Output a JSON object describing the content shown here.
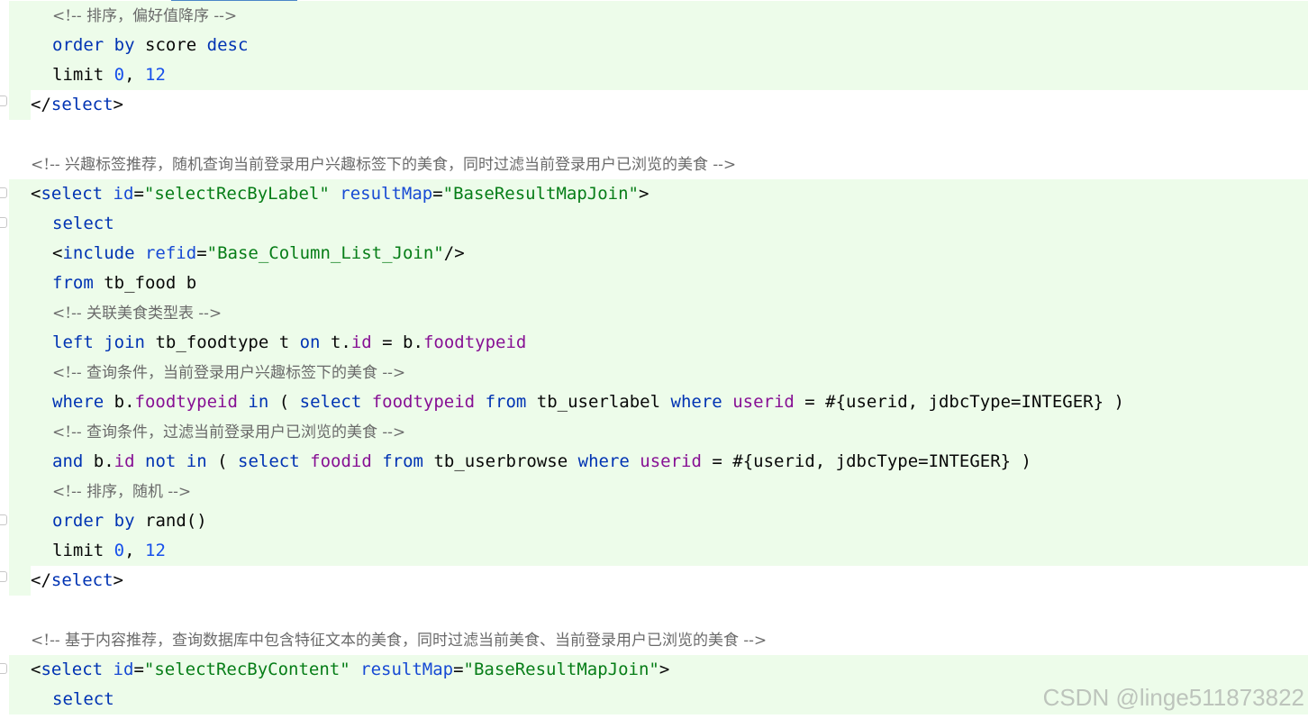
{
  "code": {
    "line01": {
      "comment": "<!-- 排序，偏好值降序 -->"
    },
    "line02": {
      "kw1": "order",
      "kw2": "by",
      "ident": "score",
      "kw3": "desc"
    },
    "line03": {
      "kw": "limit",
      "n1": "0",
      "sep": ", ",
      "n2": "12"
    },
    "line04": {
      "open": "</",
      "tag": "select",
      "close": ">"
    },
    "line06": {
      "comment": "<!-- 兴趣标签推荐，随机查询当前登录用户兴趣标签下的美食，同时过滤当前登录用户已浏览的美食 -->"
    },
    "line07": {
      "lt": "<",
      "tag": "select",
      "attr1": "id",
      "eq1": "=",
      "val1": "\"selectRecByLabel\"",
      "attr2": "resultMap",
      "eq2": "=",
      "val2": "\"BaseResultMapJoin\"",
      "gt": ">"
    },
    "line08": {
      "kw": "select"
    },
    "line09": {
      "lt": "<",
      "tag": "include",
      "attr": "refid",
      "eq": "=",
      "val": "\"Base_Column_List_Join\"",
      "end": "/>"
    },
    "line10": {
      "kw": "from",
      "rest": "tb_food b"
    },
    "line11": {
      "comment": "<!-- 关联美食类型表 -->"
    },
    "line12": {
      "kw1": "left",
      "kw2": "join",
      "t1": "tb_foodtype t",
      "kw3": "on",
      "t2": "t.",
      "f1": "id",
      "t3": " = b.",
      "f2": "foodtypeid"
    },
    "line13": {
      "comment": "<!-- 查询条件，当前登录用户兴趣标签下的美食 -->"
    },
    "line14": {
      "kw1": "where",
      "t1": "b.",
      "f1": "foodtypeid",
      "kw2": "in",
      "t2": "(",
      "kw3": "select",
      "f2": "foodtypeid",
      "kw4": "from",
      "t3": "tb_userlabel",
      "kw5": "where",
      "f3": "userid",
      "t4": "= #{userid, jdbcType=INTEGER} )"
    },
    "line15": {
      "comment": "<!-- 查询条件，过滤当前登录用户已浏览的美食 -->"
    },
    "line16": {
      "kw1": "and",
      "t1": "b.",
      "f1": "id",
      "kw2": "not",
      "kw3": "in",
      "t2": "(",
      "kw4": "select",
      "f2": "foodid",
      "kw5": "from",
      "t3": "tb_userbrowse",
      "kw6": "where",
      "f3": "userid",
      "t4": "= #{userid, jdbcType=INTEGER} )"
    },
    "line17": {
      "comment": "<!-- 排序，随机 -->"
    },
    "line18": {
      "kw1": "order",
      "kw2": "by",
      "rest": "rand()"
    },
    "line19": {
      "kw": "limit",
      "n1": "0",
      "sep": ", ",
      "n2": "12"
    },
    "line20": {
      "open": "</",
      "tag": "select",
      "close": ">"
    },
    "line22": {
      "comment": "<!-- 基于内容推荐，查询数据库中包含特征文本的美食，同时过滤当前美食、当前登录用户已浏览的美食 -->"
    },
    "line23": {
      "lt": "<",
      "tag": "select",
      "attr1": "id",
      "eq1": "=",
      "val1": "\"selectRecByContent\"",
      "attr2": "resultMap",
      "eq2": "=",
      "val2": "\"BaseResultMapJoin\"",
      "gt": ">"
    },
    "line24": {
      "kw": "select"
    }
  },
  "watermark": "CSDN @linge511873822",
  "colors": {
    "keyword": "#0033b3",
    "string": "#067d17",
    "number": "#1750eb",
    "field": "#871094",
    "comment": "#6a6a6a",
    "highlight": "#edfcea"
  }
}
